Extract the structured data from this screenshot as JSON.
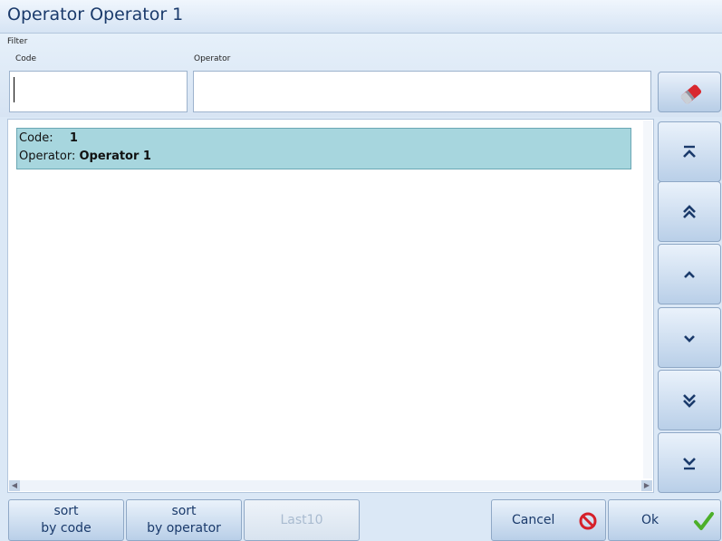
{
  "window": {
    "title": "Operator Operator 1"
  },
  "filter": {
    "section_label": "Filter",
    "code_label": "Code",
    "operator_label": "Operator",
    "code_value": "",
    "operator_value": ""
  },
  "list": {
    "items": [
      {
        "code_label": "Code:",
        "code_value": "1",
        "operator_label": "Operator:",
        "operator_value": "Operator 1"
      }
    ]
  },
  "nav": {
    "buttons": [
      "first-icon",
      "page-up-icon",
      "up-icon",
      "down-icon",
      "page-down-icon",
      "last-icon"
    ]
  },
  "bottom": {
    "sort_code_line1": "sort",
    "sort_code_line2": "by code",
    "sort_operator_line1": "sort",
    "sort_operator_line2": "by operator",
    "last10_label": "Last10",
    "cancel_label": "Cancel",
    "ok_label": "Ok"
  },
  "colors": {
    "selected_row": "#a7d6de",
    "title_text": "#1a3a6b",
    "cancel_icon": "#d6202a",
    "ok_icon": "#4caf2a"
  }
}
